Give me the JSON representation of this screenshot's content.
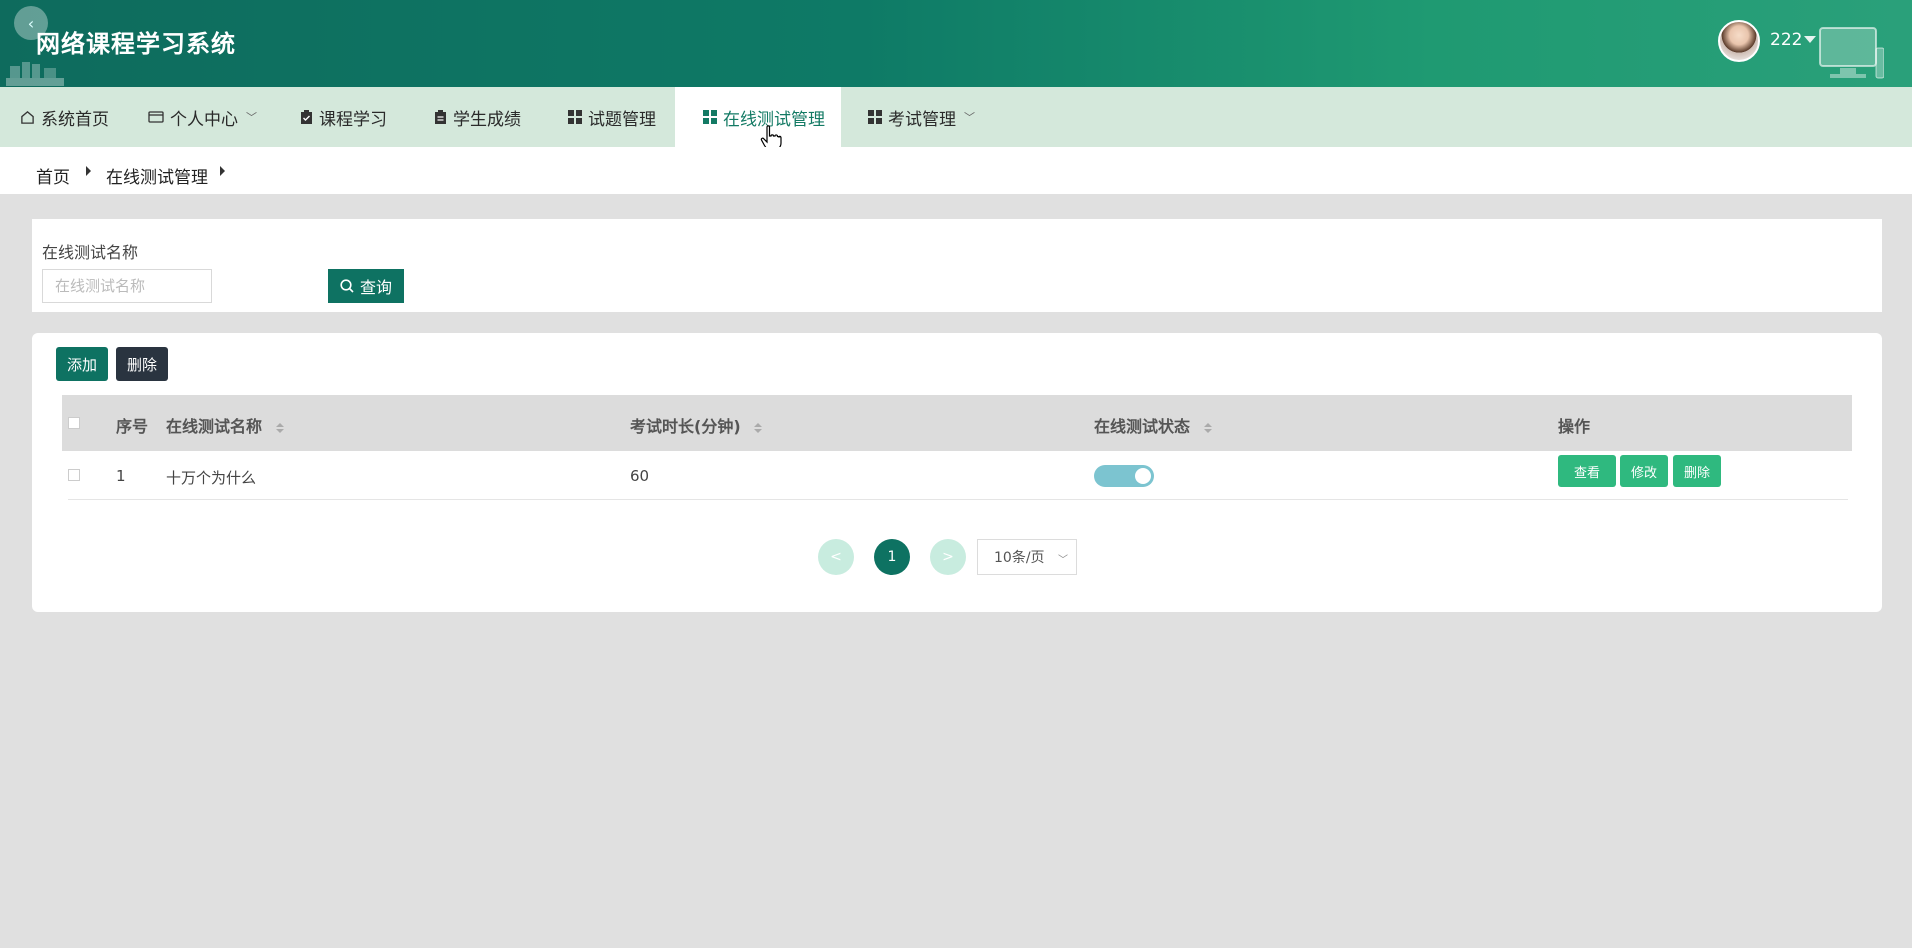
{
  "app": {
    "title": "网络课程学习系统",
    "username": "222"
  },
  "nav": {
    "items": [
      {
        "label": "系统首页",
        "icon": "home-icon"
      },
      {
        "label": "个人中心",
        "icon": "card-icon",
        "dropdown": true
      },
      {
        "label": "课程学习",
        "icon": "clipboard-icon"
      },
      {
        "label": "学生成绩",
        "icon": "clipboard-icon"
      },
      {
        "label": "试题管理",
        "icon": "grid-icon"
      },
      {
        "label": "在线测试管理",
        "icon": "grid-icon",
        "active": true
      },
      {
        "label": "考试管理",
        "icon": "grid-icon",
        "dropdown": true
      }
    ]
  },
  "breadcrumb": {
    "home": "首页",
    "current": "在线测试管理"
  },
  "search": {
    "label": "在线测试名称",
    "placeholder": "在线测试名称",
    "value": "",
    "button": "查询"
  },
  "toolbar": {
    "add": "添加",
    "delete": "删除"
  },
  "table": {
    "columns": [
      "序号",
      "在线测试名称",
      "考试时长(分钟)",
      "在线测试状态",
      "操作"
    ],
    "rows": [
      {
        "index": "1",
        "name": "十万个为什么",
        "duration": "60",
        "status_on": true,
        "actions": [
          "查看",
          "修改",
          "删除"
        ]
      }
    ]
  },
  "pagination": {
    "prev": "<",
    "current": "1",
    "next": ">",
    "page_size": "10条/页"
  },
  "colors": {
    "primary": "#0e7262",
    "nav_bg": "#d4e8db",
    "action_green": "#2fb97f",
    "toggle_on": "#7cc4d0"
  }
}
